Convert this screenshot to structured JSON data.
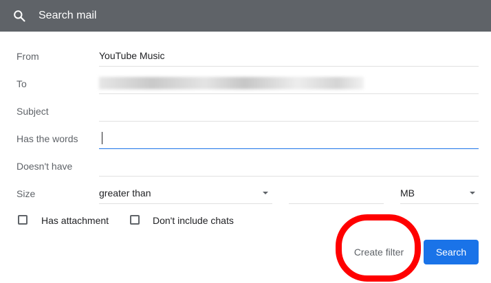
{
  "header": {
    "search_placeholder": "Search mail",
    "icon": "search-icon"
  },
  "form": {
    "from": {
      "label": "From",
      "value": "YouTube Music"
    },
    "to": {
      "label": "To",
      "value": ""
    },
    "subject": {
      "label": "Subject",
      "value": ""
    },
    "has_words": {
      "label": "Has the words",
      "value": ""
    },
    "doesnt_have": {
      "label": "Doesn't have",
      "value": ""
    },
    "size": {
      "label": "Size",
      "operator": "greater than",
      "amount": "",
      "unit": "MB"
    },
    "has_attachment": {
      "label": "Has attachment",
      "checked": false
    },
    "dont_include_chats": {
      "label": "Don't include chats",
      "checked": false
    }
  },
  "actions": {
    "create_filter": "Create filter",
    "search": "Search"
  },
  "colors": {
    "header_bg": "#5f6368",
    "primary": "#1a73e8",
    "annotation": "#ff0000"
  }
}
